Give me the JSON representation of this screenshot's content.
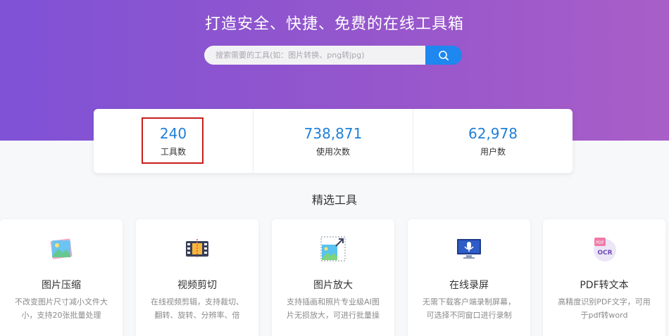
{
  "hero": {
    "title": "打造安全、快捷、免费的在线工具箱",
    "search_placeholder": "搜索需要的工具(如：图片转换、png转jpg)",
    "search_icon": "search-icon"
  },
  "stats": [
    {
      "value": "240",
      "label": "工具数"
    },
    {
      "value": "738,871",
      "label": "使用次数"
    },
    {
      "value": "62,978",
      "label": "用户数"
    }
  ],
  "section": {
    "title": "精选工具"
  },
  "tools": [
    {
      "name": "图片压缩",
      "desc": "不改变图片尺寸减小文件大小，支持20张批量处理",
      "icon": "image-compress-icon"
    },
    {
      "name": "视频剪切",
      "desc": "在线视频剪辑，支持裁切、翻转、旋转、分辨率、倍速、循",
      "icon": "video-cut-icon"
    },
    {
      "name": "图片放大",
      "desc": "支持插画和照片专业级AI图片无损放大，可进行批量操作",
      "icon": "image-enlarge-icon"
    },
    {
      "name": "在线录屏",
      "desc": "无需下载客户端录制屏幕，可选择不同窗口进行录制",
      "icon": "screen-record-icon"
    },
    {
      "name": "PDF转文本",
      "desc": "高精度识别PDF文字，可用于pdf转word",
      "icon": "pdf-ocr-icon"
    }
  ],
  "colors": {
    "accent": "#1e87f0",
    "stat_number": "#1f7fd8",
    "hero_start": "#7f52d6",
    "hero_end": "#a95ec8",
    "highlight": "#c81e1e"
  }
}
